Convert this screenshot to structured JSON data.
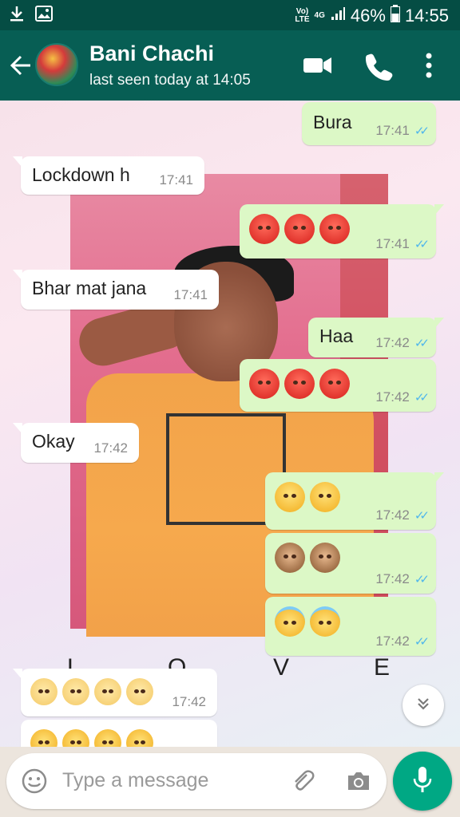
{
  "status_bar": {
    "volte_label": "VoLTE",
    "network_label": "4G",
    "battery_percent": "46%",
    "time": "14:55"
  },
  "header": {
    "contact_name": "Bani Chachi",
    "last_seen": "last seen today at 14:05"
  },
  "wallpaper": {
    "letters": [
      "L",
      "O",
      "V",
      "E"
    ]
  },
  "messages": [
    {
      "direction": "out",
      "text": "Bura",
      "time": "17:41",
      "ticks": "✓✓"
    },
    {
      "direction": "in",
      "text": "Lockdown h",
      "time": "17:41"
    },
    {
      "direction": "out",
      "emoji": [
        "angry",
        "angry",
        "angry"
      ],
      "time": "17:41",
      "ticks": "✓✓"
    },
    {
      "direction": "in",
      "text": "Bhar mat jana",
      "time": "17:41"
    },
    {
      "direction": "out",
      "text": "Haa",
      "time": "17:42",
      "ticks": "✓✓"
    },
    {
      "direction": "out",
      "emoji": [
        "angry",
        "angry",
        "angry"
      ],
      "time": "17:42",
      "ticks": "✓✓"
    },
    {
      "direction": "in",
      "text": "Okay",
      "time": "17:42"
    },
    {
      "direction": "out",
      "emoji": [
        "loudly-crying",
        "loudly-crying"
      ],
      "time": "17:42",
      "ticks": "✓✓"
    },
    {
      "direction": "out",
      "emoji": [
        "speak-no-evil-monkey",
        "speak-no-evil-monkey"
      ],
      "time": "17:42",
      "ticks": "✓✓"
    },
    {
      "direction": "out",
      "emoji": [
        "smiling-with-halo",
        "smiling-with-halo"
      ],
      "time": "17:42",
      "ticks": "✓✓"
    },
    {
      "direction": "in",
      "emoji": [
        "hatching-chick",
        "hatching-chick",
        "hatching-chick",
        "hatching-chick"
      ],
      "time": "17:42"
    },
    {
      "direction": "in",
      "emoji": [
        "face-with-raised-eyebrow",
        "face-with-raised-eyebrow",
        "face-with-raised-eyebrow",
        "face-with-raised-eyebrow"
      ]
    }
  ],
  "composer": {
    "placeholder": "Type a message"
  },
  "icons": {
    "back": "arrow-left-icon",
    "video": "video-camera-icon",
    "call": "phone-icon",
    "menu": "more-vertical-icon",
    "emoji": "emoji-icon",
    "attach": "paperclip-icon",
    "camera": "camera-icon",
    "mic": "microphone-icon",
    "scroll": "chevrons-down-icon"
  },
  "colors": {
    "header_bg": "#075e54",
    "status_bg": "#054d44",
    "outgoing_bubble": "#dcf8c6",
    "incoming_bubble": "#ffffff",
    "read_ticks": "#4fb6ec",
    "mic_button": "#00a884"
  }
}
